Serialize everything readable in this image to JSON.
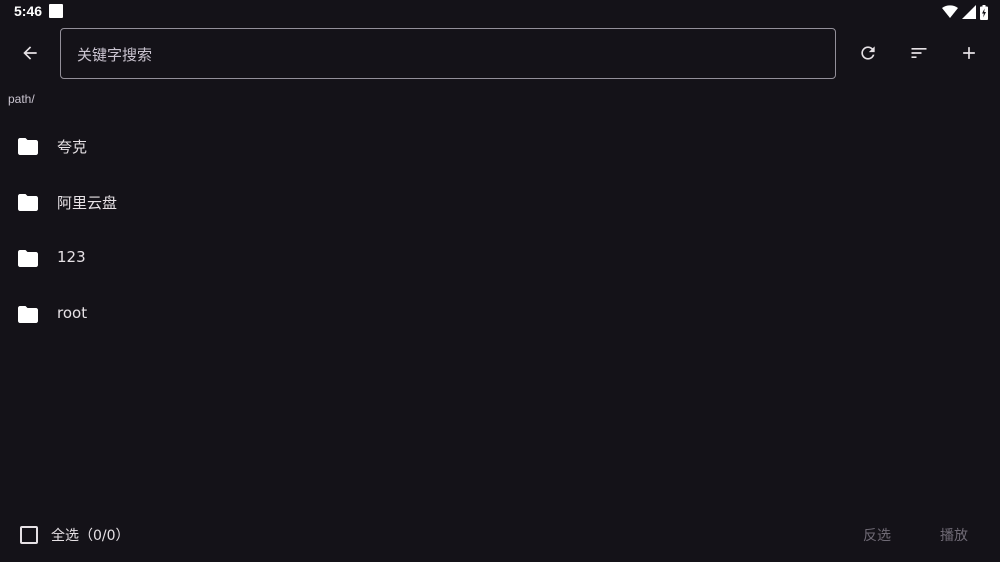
{
  "status_bar": {
    "time": "5:46",
    "icons": [
      "notification-square-icon",
      "wifi-icon",
      "signal-icon",
      "battery-charging-icon"
    ]
  },
  "app_bar": {
    "back_icon": "arrow-back-icon",
    "search": {
      "placeholder": "关键字搜索",
      "value": ""
    },
    "actions": [
      "refresh-icon",
      "sort-icon",
      "add-icon"
    ]
  },
  "path": "path/",
  "files": [
    {
      "label": "夸克",
      "icon": "folder-icon"
    },
    {
      "label": "阿里云盘",
      "icon": "folder-icon"
    },
    {
      "label": "123",
      "icon": "folder-icon"
    },
    {
      "label": "root",
      "icon": "folder-icon"
    }
  ],
  "bottom_bar": {
    "select_all_label": "全选（0/0）",
    "select_all_checked": false,
    "invert_label": "反选",
    "play_label": "播放"
  },
  "colors": {
    "background": "#141218",
    "text": "#e6e1e5",
    "outline": "#938f99",
    "disabled_text": "#6f6a75"
  }
}
